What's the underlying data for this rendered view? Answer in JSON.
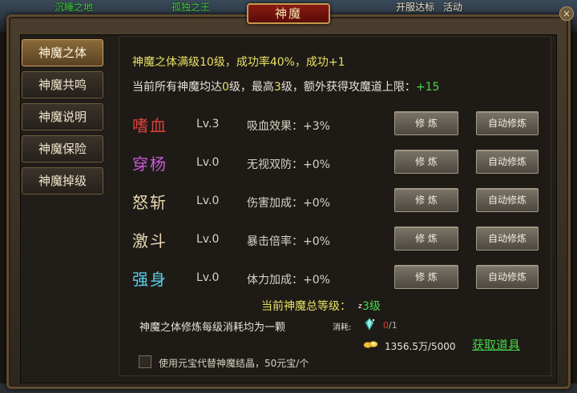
{
  "scene": {
    "labels": [
      "沉睡之地",
      "孤独之王",
      "开服达标",
      "活动"
    ]
  },
  "window": {
    "title": "神魔",
    "close_label": "×"
  },
  "tabs": [
    {
      "label": "神魔之体",
      "active": true
    },
    {
      "label": "神魔共鸣",
      "active": false
    },
    {
      "label": "神魔说明",
      "active": false
    },
    {
      "label": "神魔保险",
      "active": false
    },
    {
      "label": "神魔掉级",
      "active": false
    }
  ],
  "info": {
    "max_line": "神魔之体满级10级，成功率40%，成功+1",
    "bonus_prefix": "当前所有神魔均达",
    "bonus_min": "0",
    "bonus_mid": "级，最高",
    "bonus_max": "3",
    "bonus_suffix": "级，额外获得攻魔道上限：",
    "bonus_value": "+15"
  },
  "skills": [
    {
      "name": "嗜血",
      "color": "#e0403a",
      "level": "Lv.3",
      "effect": "吸血效果：+3%"
    },
    {
      "name": "穿杨",
      "color": "#c85ad8",
      "level": "Lv.0",
      "effect": "无视双防：+0%"
    },
    {
      "name": "怒斩",
      "color": "#e8d8b0",
      "level": "Lv.0",
      "effect": "伤害加成：+0%"
    },
    {
      "name": "激斗",
      "color": "#e8d8b0",
      "level": "Lv.0",
      "effect": "暴击倍率：+0%"
    },
    {
      "name": "强身",
      "color": "#5ad0e8",
      "level": "Lv.0",
      "effect": "体力加成：+0%"
    }
  ],
  "buttons": {
    "practice": "修 炼",
    "auto_practice": "自动修炼"
  },
  "total": {
    "label": "当前神魔总等级：",
    "value": "3级",
    "cursor": "z"
  },
  "cost": {
    "description": "神魔之体修炼每级消耗均为一颗",
    "label": "消耗:",
    "have": "0",
    "need": "/1",
    "crystal_icon": "crystal-icon",
    "have_color": "#e03a2a"
  },
  "gold": {
    "icon": "gold-ingot-icon",
    "amount": "1356.5万/5000",
    "get_link": "获取道具"
  },
  "option": {
    "label": "使用元宝代替神魔结晶，50元宝/个",
    "checked": false
  }
}
